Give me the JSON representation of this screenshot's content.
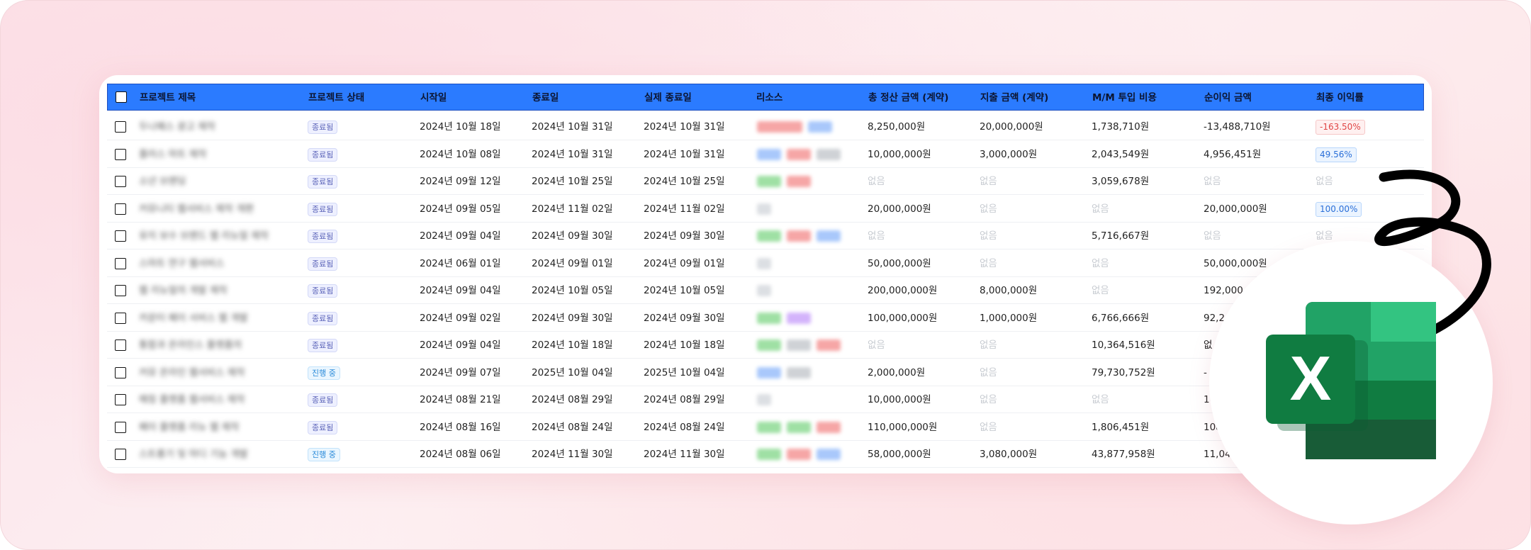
{
  "columns": [
    "프로젝트 제목",
    "프로젝트 상태",
    "시작일",
    "종료일",
    "실제 종료일",
    "리소스",
    "총 정산 금액 (계약)",
    "지출 금액 (계약)",
    "M/M 투입 비용",
    "순이익 금액",
    "최종 이익률"
  ],
  "rows": [
    {
      "title": "두나패스 광고 제작",
      "status": "종료됨",
      "status_type": "done",
      "start": "2024년 10월 18일",
      "end": "2024년 10월 31일",
      "actual_end": "2024년 10월 31일",
      "chips": [
        "#f6a6a6",
        "#a9c8fb"
      ],
      "total": "8,250,000원",
      "expense": "20,000,000원",
      "mm": "1,738,710원",
      "profit": "-13,488,710원",
      "rate": "-163.50%",
      "rate_type": "neg"
    },
    {
      "title": "플러스 마트 제작",
      "status": "종료됨",
      "status_type": "done",
      "start": "2024년 10월 08일",
      "end": "2024년 10월 31일",
      "actual_end": "2024년 10월 31일",
      "chips": [
        "#a9c8fb",
        "#f6a6a6",
        "#cfd2d6"
      ],
      "total": "10,000,000원",
      "expense": "3,000,000원",
      "mm": "2,043,549원",
      "profit": "4,956,451원",
      "rate": "49.56%",
      "rate_type": "pos"
    },
    {
      "title": "소년 브랜딩",
      "status": "종료됨",
      "status_type": "done",
      "start": "2024년 09월 12일",
      "end": "2024년 10월 25일",
      "actual_end": "2024년 10월 25일",
      "chips": [
        "#9fe0a4",
        "#f6a6a6"
      ],
      "total": "없음",
      "expense": "없음",
      "mm": "3,059,678원",
      "profit": "없음",
      "rate": "없음",
      "rate_type": "none"
    },
    {
      "title": "커뮤니티 웹서비스 제작 개편",
      "status": "종료됨",
      "status_type": "done",
      "start": "2024년 09월 05일",
      "end": "2024년 11월 02일",
      "actual_end": "2024년 11월 02일",
      "chips": [
        "#dcdfe3"
      ],
      "total": "20,000,000원",
      "expense": "없음",
      "mm": "없음",
      "profit": "20,000,000원",
      "rate": "100.00%",
      "rate_type": "pos"
    },
    {
      "title": "유지 보수 브랜드 웹 리뉴얼 제작",
      "status": "종료됨",
      "status_type": "done",
      "start": "2024년 09월 04일",
      "end": "2024년 09월 30일",
      "actual_end": "2024년 09월 30일",
      "chips": [
        "#9fe0a4",
        "#f6a6a6",
        "#a9c8fb"
      ],
      "total": "없음",
      "expense": "없음",
      "mm": "5,716,667원",
      "profit": "없음",
      "rate": "없음",
      "rate_type": "none"
    },
    {
      "title": "스마트 연구 웹서비스",
      "status": "종료됨",
      "status_type": "done",
      "start": "2024년 06월 01일",
      "end": "2024년 09월 01일",
      "actual_end": "2024년 09월 01일",
      "chips": [
        "#dcdfe3"
      ],
      "total": "50,000,000원",
      "expense": "없음",
      "mm": "없음",
      "profit": "50,000,000원",
      "rate": "",
      "rate_type": "none"
    },
    {
      "title": "웹 리뉴얼의 개발 제작",
      "status": "종료됨",
      "status_type": "done",
      "start": "2024년 09월 04일",
      "end": "2024년 10월 05일",
      "actual_end": "2024년 10월 05일",
      "chips": [
        "#dcdfe3"
      ],
      "total": "200,000,000원",
      "expense": "8,000,000원",
      "mm": "없음",
      "profit": "192,000",
      "rate": "",
      "rate_type": "none"
    },
    {
      "title": "카운터 페이 서비스 웹 개발",
      "status": "종료됨",
      "status_type": "done",
      "start": "2024년 09월 02일",
      "end": "2024년 09월 30일",
      "actual_end": "2024년 09월 30일",
      "chips": [
        "#9fe0a4",
        "#d3b3fb"
      ],
      "total": "100,000,000원",
      "expense": "1,000,000원",
      "mm": "6,766,666원",
      "profit": "92,2",
      "rate": "",
      "rate_type": "none"
    },
    {
      "title": "통합과 온라인스 플랫폼의",
      "status": "종료됨",
      "status_type": "done",
      "start": "2024년 09월 04일",
      "end": "2024년 10월 18일",
      "actual_end": "2024년 10월 18일",
      "chips": [
        "#9fe0a4",
        "#cfd2d6",
        "#f6a6a6"
      ],
      "total": "없음",
      "expense": "없음",
      "mm": "10,364,516원",
      "profit": "없",
      "rate": "",
      "rate_type": "none"
    },
    {
      "title": "커뮤 온라인 웹서비스 제작",
      "status": "진행 중",
      "status_type": "prog",
      "start": "2024년 09월 07일",
      "end": "2025년 10월 04일",
      "actual_end": "2025년 10월 04일",
      "chips": [
        "#a9c8fb",
        "#cfd2d6"
      ],
      "total": "2,000,000원",
      "expense": "없음",
      "mm": "79,730,752원",
      "profit": "-",
      "rate": "",
      "rate_type": "none"
    },
    {
      "title": "매칭 플랫폼 웹서비스 제작",
      "status": "종료됨",
      "status_type": "done",
      "start": "2024년 08월 21일",
      "end": "2024년 08월 29일",
      "actual_end": "2024년 08월 29일",
      "chips": [
        "#dcdfe3"
      ],
      "total": "10,000,000원",
      "expense": "없음",
      "mm": "없음",
      "profit": "1(",
      "rate": "",
      "rate_type": "none"
    },
    {
      "title": "페이 플랫폼 리뉴 웹 제작",
      "status": "종료됨",
      "status_type": "done",
      "start": "2024년 08월 16일",
      "end": "2024년 08월 24일",
      "actual_end": "2024년 08월 24일",
      "chips": [
        "#9fe0a4",
        "#9fe0a4",
        "#f6a6a6"
      ],
      "total": "110,000,000원",
      "expense": "없음",
      "mm": "1,806,451원",
      "profit": "108",
      "rate": "",
      "rate_type": "none"
    },
    {
      "title": "스트롱기 및 마디 기능 개발",
      "status": "진행 중",
      "status_type": "prog",
      "start": "2024년 08월 06일",
      "end": "2024년 11월 30일",
      "actual_end": "2024년 11월 30일",
      "chips": [
        "#9fe0a4",
        "#f6a6a6",
        "#a9c8fb"
      ],
      "total": "58,000,000원",
      "expense": "3,080,000원",
      "mm": "43,877,958원",
      "profit": "11,042",
      "rate": "",
      "rate_type": "none"
    }
  ],
  "excel_logo_letter": "X",
  "colors": {
    "header": "#2b7bff",
    "excel_dark": "#185c37",
    "excel_mid": "#21a366",
    "excel_light": "#33c481"
  }
}
